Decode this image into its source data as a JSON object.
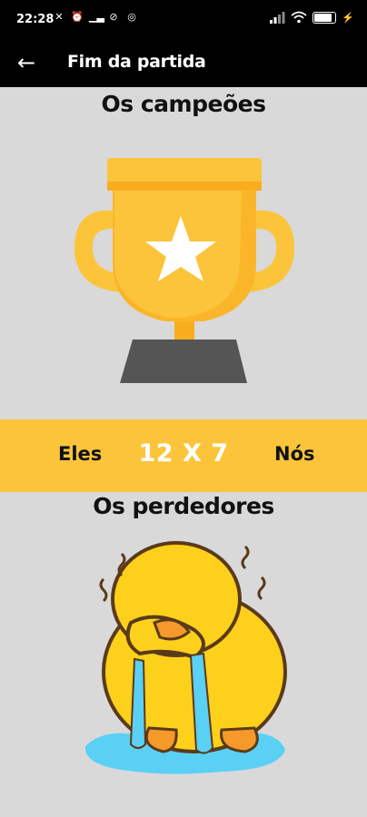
{
  "status_bar": {
    "time": "22:28",
    "icons_left": [
      "mute-icon",
      "alarm-icon",
      "signal-small-icon",
      "sync-off-icon",
      "data-saver-icon"
    ],
    "battery_level": 0.8
  },
  "app_bar": {
    "back_icon": "arrow-left-icon",
    "title": "Fim da partida"
  },
  "winners": {
    "title": "Os campeões",
    "image": "trophy-star-icon"
  },
  "score": {
    "left_team": "Eles",
    "value": "12 X 7",
    "right_team": "Nós"
  },
  "losers": {
    "title": "Os perdedores",
    "image": "crying-duck-sticker"
  },
  "colors": {
    "band": "#fcc43a",
    "background": "#d9d9d9",
    "bar": "#000000"
  }
}
